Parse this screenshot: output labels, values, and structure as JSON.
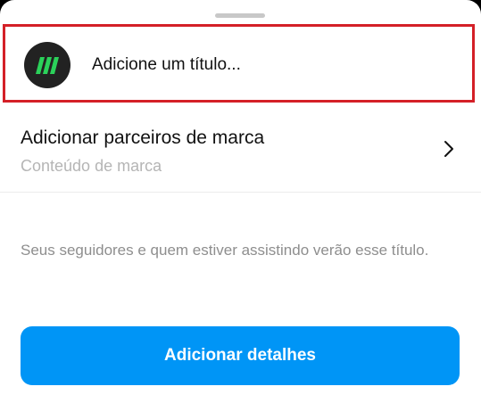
{
  "title_row": {
    "avatar_icon": "brand-logo-icon",
    "avatar_colors": {
      "background": "#222222",
      "mark": "#2bd15a"
    },
    "placeholder": "Adicione um título..."
  },
  "partners": {
    "title": "Adicionar parceiros de marca",
    "subtitle": "Conteúdo de marca",
    "icon": "chevron-right-icon"
  },
  "info": {
    "text": "Seus seguidores e quem estiver assistindo verão esse título."
  },
  "primary_button": {
    "label": "Adicionar detalhes",
    "color": "#0095f6"
  },
  "highlight_color": "#d42027"
}
